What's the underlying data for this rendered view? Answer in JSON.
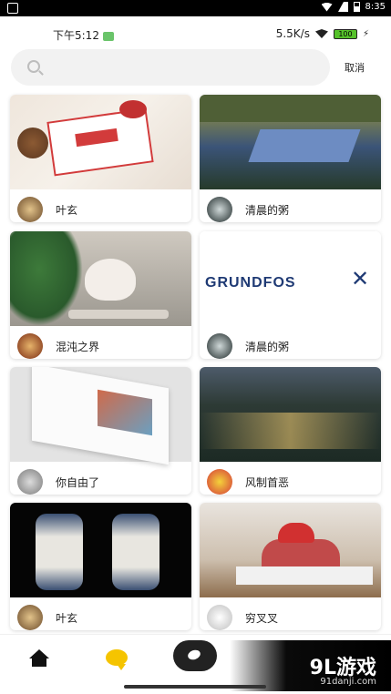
{
  "system_bar": {
    "time": "8:35"
  },
  "phone_status": {
    "time": "下午5:12",
    "speed": "5.5K/s",
    "battery": "100"
  },
  "search": {
    "placeholder": "",
    "cancel_label": "取消"
  },
  "cards": [
    {
      "author": "叶玄",
      "image_icon": "new-year-envelope-image"
    },
    {
      "author": "清晨的粥",
      "image_icon": "river-landscape-image"
    },
    {
      "author": "混沌之界",
      "image_icon": "white-cat-image"
    },
    {
      "author": "清晨的粥",
      "image_icon": "grundfos-logo-image",
      "brand_text": "GRUNDFOS"
    },
    {
      "author": "你自由了",
      "image_icon": "open-magazine-image"
    },
    {
      "author": "风制首恶",
      "image_icon": "garden-night-image"
    },
    {
      "author": "叶玄",
      "image_icon": "porcelain-lamps-image"
    },
    {
      "author": "穷叉叉",
      "image_icon": "man-reading-newspaper-image"
    }
  ],
  "bottom_nav": {
    "items": [
      "home-icon",
      "chat-icon",
      "center-icon"
    ],
    "banner_text": "9L游戏",
    "banner_url": "91danji.com"
  },
  "colors": {
    "accent": "#f5c400",
    "text": "#222222",
    "background": "#ffffff"
  }
}
